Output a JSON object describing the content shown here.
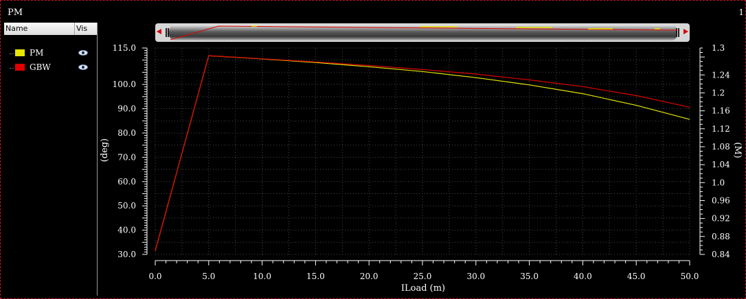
{
  "window": {
    "title": "PM",
    "corner_text": "1"
  },
  "legend": {
    "header": {
      "name": "Name",
      "vis": "Vis"
    },
    "items": [
      {
        "label": "PM",
        "color": "#e6e600",
        "icon": "eye-icon"
      },
      {
        "label": "GBW",
        "color": "#e00000",
        "icon": "eye-icon"
      }
    ]
  },
  "chart_data": {
    "type": "line",
    "title": "",
    "xlabel": "ILoad (m)",
    "ylabel_left": "(deg)",
    "ylabel_right": "(M)",
    "xlim": [
      0,
      50
    ],
    "ylim_left": [
      30,
      115
    ],
    "ylim_right": [
      0.84,
      1.3
    ],
    "x_ticks": [
      "0.0",
      "5.0",
      "10.0",
      "15.0",
      "20.0",
      "25.0",
      "30.0",
      "35.0",
      "40.0",
      "45.0",
      "50.0"
    ],
    "y_ticks_left": [
      "30.0",
      "40.0",
      "50.0",
      "60.0",
      "70.0",
      "80.0",
      "90.0",
      "100.0",
      "115.0"
    ],
    "y_ticks_right": [
      "0.84",
      "0.88",
      "0.92",
      "0.96",
      "1.0",
      "1.04",
      "1.08",
      "1.12",
      "1.16",
      "1.2",
      "1.24",
      "1.3"
    ],
    "grid": true,
    "series": [
      {
        "name": "PM",
        "axis": "left",
        "color": "#e6e600",
        "x": [
          0,
          5,
          10,
          15,
          20,
          25,
          30,
          35,
          40,
          45,
          50
        ],
        "y": [
          31.5,
          111.8,
          110.5,
          109.0,
          107.3,
          105.3,
          102.8,
          99.8,
          96.2,
          91.4,
          85.6
        ]
      },
      {
        "name": "GBW",
        "axis": "right",
        "color": "#e00000",
        "x": [
          0,
          5,
          10,
          15,
          20,
          25,
          30,
          35,
          40,
          45,
          50
        ],
        "y": [
          0.848,
          1.283,
          1.276,
          1.269,
          1.261,
          1.252,
          1.242,
          1.229,
          1.214,
          1.194,
          1.168
        ]
      }
    ]
  }
}
